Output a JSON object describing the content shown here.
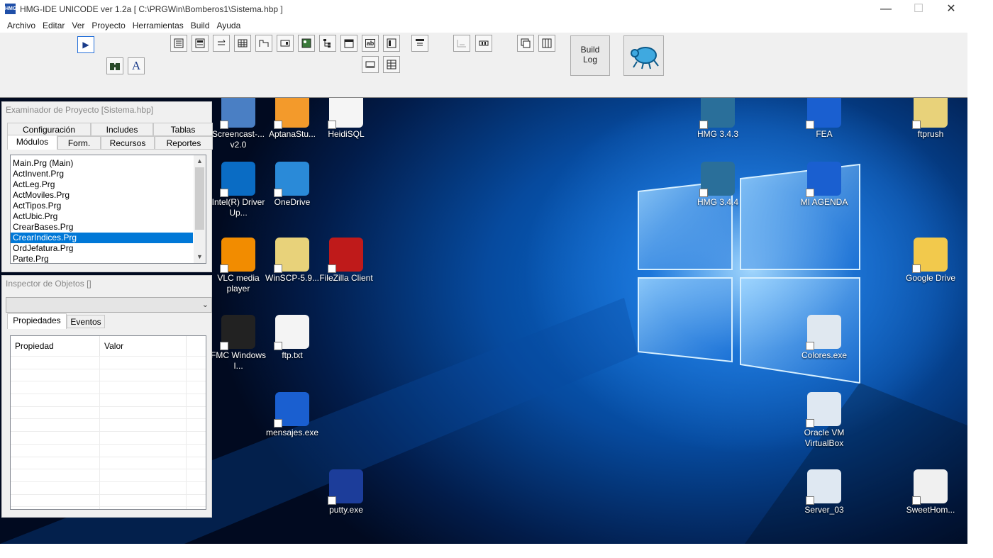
{
  "window": {
    "title": "HMG-IDE  UNICODE  ver 1.2a  [ C:\\PRGWin\\Bomberos1\\Sistema.hbp ]",
    "icon_text": "HMG",
    "minimize": "—",
    "maximize": "☐",
    "close": "✕"
  },
  "menu": [
    "Archivo",
    "Editar",
    "Ver",
    "Proyecto",
    "Herramientas",
    "Build",
    "Ayuda"
  ],
  "toolbar": {
    "run_glyph": "▶",
    "font_glyph": "A",
    "build_log_line1": "Build",
    "build_log_line2": "Log"
  },
  "project_explorer": {
    "title": "Examinador de Proyecto [Sistema.hbp]",
    "tabs_top": [
      "Configuración",
      "Includes",
      "Tablas"
    ],
    "tabs_bottom": [
      "Módulos",
      "Form.",
      "Recursos",
      "Reportes"
    ],
    "modules": [
      "Main.Prg (Main)",
      "ActInvent.Prg",
      "ActLeg.Prg",
      "ActMoviles.Prg",
      "ActTipos.Prg",
      "ActUbic.Prg",
      "CrearBases.Prg",
      "CrearIndices.Prg",
      "OrdJefatura.Prg",
      "Parte.Prg"
    ],
    "selected_index": 7
  },
  "object_inspector": {
    "title": "Inspector de Objetos []",
    "combo_value": "",
    "tabs": [
      "Propiedades",
      "Eventos"
    ],
    "columns": [
      "Propiedad",
      "Valor"
    ]
  },
  "desktop_icons": [
    {
      "label": "Screencast-... v2.0",
      "col": 0,
      "row": 0,
      "color": "#4a7fc4",
      "icon": "screencast-icon"
    },
    {
      "label": "AptanaStu...",
      "col": 1,
      "row": 0,
      "color": "#f39a2b",
      "icon": "gear-icon"
    },
    {
      "label": "HeidiSQL",
      "col": 2,
      "row": 0,
      "color": "#f5f5f5",
      "icon": "heidisql-icon"
    },
    {
      "label": "Intel(R) Driver Up...",
      "col": 0,
      "row": 1,
      "color": "#0a6cc4",
      "icon": "intel-icon"
    },
    {
      "label": "OneDrive",
      "col": 1,
      "row": 1,
      "color": "#2a8ad8",
      "icon": "cloud-icon"
    },
    {
      "label": "VLC media player",
      "col": 0,
      "row": 2,
      "color": "#f28c00",
      "icon": "vlc-cone-icon"
    },
    {
      "label": "WinSCP-5.9...",
      "col": 1,
      "row": 2,
      "color": "#e8d27a",
      "icon": "folder-icon"
    },
    {
      "label": "FileZilla Client",
      "col": 2,
      "row": 2,
      "color": "#bf1a1a",
      "icon": "filezilla-icon"
    },
    {
      "label": "FMC Windows I...",
      "col": 0,
      "row": 3,
      "color": "#222222",
      "icon": "package-icon"
    },
    {
      "label": "ftp.txt",
      "col": 1,
      "row": 3,
      "color": "#f4f4f4",
      "icon": "text-file-icon"
    },
    {
      "label": "mensajes.exe",
      "col": 1,
      "row": 4,
      "color": "#1a5fd0",
      "icon": "gem-icon"
    },
    {
      "label": "putty.exe",
      "col": 2,
      "row": 5,
      "color": "#1c3d9a",
      "icon": "putty-icon"
    },
    {
      "label": "HMG 3.4.3",
      "col": 9,
      "row": 0,
      "color": "#2a6f9a",
      "icon": "hmg-icon"
    },
    {
      "label": "FEA",
      "col": 11,
      "row": 0,
      "color": "#1a5fd0",
      "icon": "gem-icon"
    },
    {
      "label": "ftprush",
      "col": 13,
      "row": 0,
      "color": "#e8d27a",
      "icon": "folder-icon"
    },
    {
      "label": "HMG 3.4.4",
      "col": 9,
      "row": 1,
      "color": "#2a6f9a",
      "icon": "hmg-icon"
    },
    {
      "label": "MI AGENDA",
      "col": 11,
      "row": 1,
      "color": "#1a5fd0",
      "icon": "gem-icon"
    },
    {
      "label": "Google Drive",
      "col": 13,
      "row": 2,
      "color": "#f2c94c",
      "icon": "google-drive-icon"
    },
    {
      "label": "Colores.exe",
      "col": 11,
      "row": 3,
      "color": "#e0e8f0",
      "icon": "windows-flag-icon"
    },
    {
      "label": "Oracle VM VirtualBox",
      "col": 11,
      "row": 4,
      "color": "#dfe8f2",
      "icon": "virtualbox-icon"
    },
    {
      "label": "Server_03",
      "col": 11,
      "row": 5,
      "color": "#dfe8f2",
      "icon": "virtualbox-icon"
    },
    {
      "label": "SweetHom...",
      "col": 13,
      "row": 5,
      "color": "#f0f0f0",
      "icon": "sweethome-icon"
    }
  ]
}
